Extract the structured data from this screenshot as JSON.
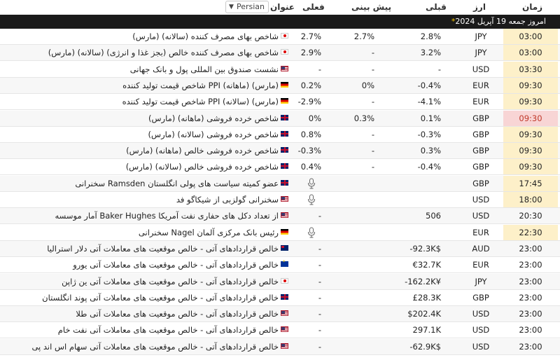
{
  "header": {
    "time": "زمان",
    "currency": "ارز",
    "previous": "قبلی",
    "forecast": "پیش بینی",
    "actual": "فعلی",
    "title": "عنوان",
    "language": "Persian"
  },
  "today_bar": {
    "star": "*",
    "label": "امروز",
    "date": "جمعه 19 آپریل 2024"
  },
  "rows": [
    {
      "time": "03:00",
      "currency": "JPY",
      "previous": "2.8%",
      "forecast": "2.7%",
      "actual": "2.7%",
      "flag": "jp",
      "title": "شاخص بهای مصرف کننده (سالانه) (مارس)"
    },
    {
      "time": "03:00",
      "currency": "JPY",
      "previous": "3.2%",
      "forecast": "-",
      "actual": "2.9%",
      "flag": "jp",
      "title": "شاخص بهای مصرف کننده خالص (بجز غذا و انرژی) (سالانه) (مارس)"
    },
    {
      "time": "03:30",
      "currency": "USD",
      "previous": "-",
      "forecast": "-",
      "actual": "-",
      "flag": "us",
      "title": "نشست صندوق بین المللی پول و بانک جهانی"
    },
    {
      "time": "09:30",
      "currency": "EUR",
      "previous": "-0.4%",
      "forecast": "0%",
      "actual": "0.2%",
      "flag": "de",
      "title": "شاخص قیمت تولید کننده PPI (ماهانه) (مارس)"
    },
    {
      "time": "09:30",
      "currency": "EUR",
      "previous": "-4.1%",
      "forecast": "-",
      "actual": "-2.9%",
      "flag": "de",
      "title": "شاخص قیمت تولید کننده PPI (سالانه) (مارس)"
    },
    {
      "time": "09:30",
      "currency": "GBP",
      "previous": "0.1%",
      "forecast": "0.3%",
      "actual": "0%",
      "flag": "gb",
      "title": "شاخص خرده فروشی (ماهانه) (مارس)",
      "highlight": true
    },
    {
      "time": "09:30",
      "currency": "GBP",
      "previous": "-0.3%",
      "forecast": "-",
      "actual": "0.8%",
      "flag": "gb",
      "title": "شاخص خرده فروشی (سالانه) (مارس)"
    },
    {
      "time": "09:30",
      "currency": "GBP",
      "previous": "0.3%",
      "forecast": "-",
      "actual": "-0.3%",
      "flag": "gb",
      "title": "شاخص خرده فروشی خالص (ماهانه) (مارس)"
    },
    {
      "time": "09:30",
      "currency": "GBP",
      "previous": "-0.4%",
      "forecast": "-",
      "actual": "0.4%",
      "flag": "gb",
      "title": "شاخص خرده فروشی خالص (سالانه) (مارس)"
    },
    {
      "time": "17:45",
      "currency": "GBP",
      "previous": "",
      "forecast": "",
      "actual": "",
      "flag": "gb",
      "title": "سخنرانی Ramsden عضو کمیته سیاست های پولی انگلستان",
      "mic": true
    },
    {
      "time": "18:00",
      "currency": "USD",
      "previous": "",
      "forecast": "",
      "actual": "",
      "flag": "us",
      "title": "سخنرانی گولزبی از شیکاگو فد",
      "mic": true
    },
    {
      "time": "20:30",
      "currency": "USD",
      "previous": "506",
      "forecast": "",
      "actual": "-",
      "flag": "us",
      "title": "آمار موسسه Baker Hughes از تعداد دکل های حفاری نفت آمریکا",
      "plain": true
    },
    {
      "time": "22:30",
      "currency": "EUR",
      "previous": "",
      "forecast": "",
      "actual": "",
      "flag": "de",
      "title": "سخنرانی Nagel رئیس بانک مرکزی آلمان",
      "mic": true
    },
    {
      "time": "23:00",
      "currency": "AUD",
      "previous": "-92.3K$",
      "forecast": "",
      "actual": "-",
      "flag": "au",
      "title": "خالص قراردادهای آتی - خالص موقعیت های معاملات آتی دلار استرالیا",
      "plain": true
    },
    {
      "time": "23:00",
      "currency": "EUR",
      "previous": "€32.7K",
      "forecast": "",
      "actual": "-",
      "flag": "eu",
      "title": "خالص قراردادهای آتی - خالص موقعیت های معاملات آتی یورو",
      "plain": true
    },
    {
      "time": "23:00",
      "currency": "JPY",
      "previous": "-162.2K¥",
      "forecast": "",
      "actual": "-",
      "flag": "jp",
      "title": "خالص قراردادهای آتی - خالص موقعیت های معاملات آتی ین ژاپن",
      "plain": true
    },
    {
      "time": "23:00",
      "currency": "GBP",
      "previous": "£28.3K",
      "forecast": "",
      "actual": "-",
      "flag": "gb",
      "title": "خالص قراردادهای آتی - خالص موقعیت های معاملات آتی پوند انگلستان",
      "plain": true
    },
    {
      "time": "23:00",
      "currency": "USD",
      "previous": "$202.4K",
      "forecast": "",
      "actual": "-",
      "flag": "us",
      "title": "خالص قراردادهای آتی - خالص موقعیت های معاملات آتی طلا",
      "plain": true
    },
    {
      "time": "23:00",
      "currency": "USD",
      "previous": "297.1K",
      "forecast": "",
      "actual": "-",
      "flag": "us",
      "title": "خالص قراردادهای آتی - خالص موقعیت های معاملات آتی نفت خام",
      "plain": true
    },
    {
      "time": "23:00",
      "currency": "USD",
      "previous": "-62.9K$",
      "forecast": "",
      "actual": "-",
      "flag": "us",
      "title": "خالص قراردادهای آتی - خالص موقعیت های معاملات آتی سهام اس اند پی",
      "plain": true
    }
  ]
}
